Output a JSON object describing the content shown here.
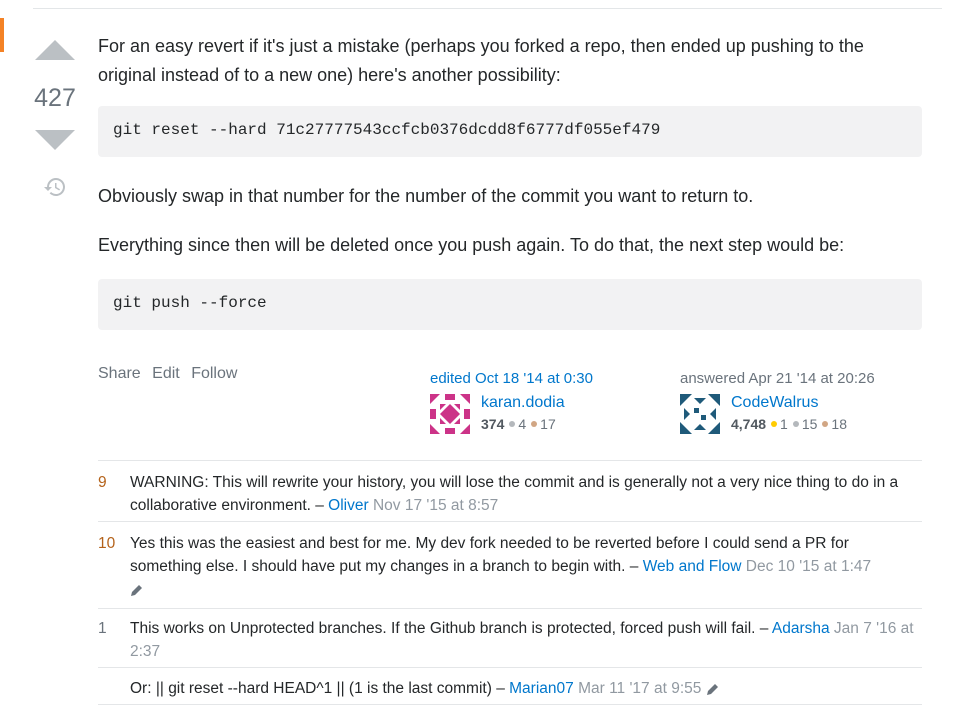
{
  "vote": {
    "count": "427"
  },
  "post": {
    "paragraph1": "For an easy revert if it's just a mistake (perhaps you forked a repo, then ended up pushing to the original instead of to a new one) here's another possibility:",
    "code1": "git reset --hard 71c27777543ccfcb0376dcdd8f6777df055ef479",
    "paragraph2": "Obviously swap in that number for the number of the commit you want to return to.",
    "paragraph3": "Everything since then will be deleted once you push again. To do that, the next step would be:",
    "code2": "git push --force"
  },
  "menu": {
    "share": "Share",
    "edit": "Edit",
    "follow": "Follow"
  },
  "editor": {
    "action": "edited Oct 18 '14 at 0:30",
    "name": "karan.dodia",
    "rep": "374",
    "silver": "4",
    "bronze": "17"
  },
  "answerer": {
    "action": "answered Apr 21 '14 at 20:26",
    "name": "CodeWalrus",
    "rep": "4,748",
    "gold": "1",
    "silver": "15",
    "bronze": "18"
  },
  "comments": [
    {
      "score": "9",
      "text": "WARNING: This will rewrite your history, you will lose the commit and is generally not a very nice thing to do in a collaborative environment. –",
      "user": "Oliver",
      "date": "Nov 17 '15 at 8:57"
    },
    {
      "score": "10",
      "text": "Yes this was the easiest and best for me. My dev fork needed to be reverted before I could send a PR for something else. I should have put my changes in a branch to begin with. –",
      "user": "Web and Flow",
      "date": "Dec 10 '15 at 1:47"
    },
    {
      "score": "1",
      "text": "This works on Unprotected branches. If the Github branch is protected, forced push will fail. –",
      "user": "Adarsha",
      "date": "Jan 7 '16 at 2:37"
    },
    {
      "score": "",
      "text": "Or: || git reset --hard HEAD^1 || (1 is the last commit) –",
      "user": "Marian07",
      "date": "Mar 11 '17 at 9:55"
    }
  ],
  "icons": {
    "history": "history-icon",
    "edit": "pencil-icon",
    "vote_up": "triangle-up",
    "vote_down": "triangle-down"
  },
  "colors": {
    "link": "#0077cc",
    "accent": "#f48225",
    "code_bg": "#f2f2f3",
    "hot_score": "#b4621a"
  }
}
